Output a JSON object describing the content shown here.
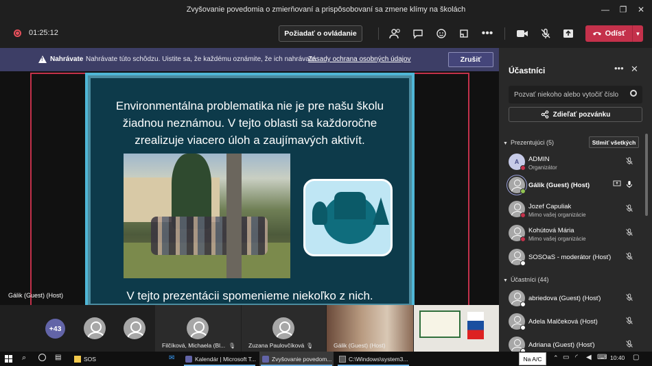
{
  "window": {
    "title": "Zvyšovanie povedomia o zmierňovaní a prispôsobovaní sa zmene klímy na školách",
    "minimize": "—",
    "maximize": "❐",
    "close": "✕"
  },
  "toolbar": {
    "timer": "01:25:12",
    "request_control": "Požiadať o ovládanie",
    "leave": "Odísť",
    "icons": [
      "participants-icon",
      "chat-icon",
      "reactions-icon",
      "rooms-icon",
      "more-icon",
      "camera-icon",
      "mic-off-icon",
      "share-icon"
    ]
  },
  "banner": {
    "title": "Nahrávate",
    "text": "Nahrávate túto schôdzu. Uistite sa, že každému oznámite, že ich nahrávate.",
    "link": "Zásady ochrana osobných údajov",
    "dismiss": "Zrušiť"
  },
  "stage": {
    "presenter_label": "Gálik (Guest) (Host)",
    "slide_text": "Environmentálna problematika nie je pre našu školu žiadnou neznámou. V tejto oblasti sa každoročne zrealizuje viacero úloh a zaujímavých aktivít.",
    "slide_bottom": "V tejto prezentácii spomenieme niekoľko z nich."
  },
  "strip": {
    "more_count": "+43",
    "tiles": [
      {
        "label": "Filčíková, Michaela (Bl..."
      },
      {
        "label": "Zuzana Paulovčíková"
      },
      {
        "label": "Gálik (Guest) (Host)"
      }
    ]
  },
  "panel": {
    "title": "Účastníci",
    "invite_placeholder": "Pozvať niekoho alebo vytočiť číslo",
    "share_invite": "Zdieľať pozvánku",
    "presenters_section": "Prezentujúci (5)",
    "mute_all": "Stlmiť všetkých",
    "attendees_section": "Účastníci (44)",
    "presenters": [
      {
        "name": "ADMIN",
        "sub": "Organizátor",
        "initial": "A",
        "status_color": "#c4314b"
      },
      {
        "name": "Gálik (Guest) (Host)",
        "sub": "",
        "initial": "",
        "status_color": "#92c353"
      },
      {
        "name": "Jozef Capuliak",
        "sub": "Mimo vašej organizácie",
        "initial": "",
        "status_color": "#c4314b"
      },
      {
        "name": "Kohútová Mária",
        "sub": "Mimo vašej organizácie",
        "initial": "",
        "status_color": "#c4314b"
      },
      {
        "name": "SOSOaS - moderátor (Hosť)",
        "sub": "",
        "initial": "",
        "status_color": "#ffffff"
      }
    ],
    "attendees": [
      {
        "name": "abriedova (Guest) (Hosť)",
        "status_color": "#ffffff"
      },
      {
        "name": "Adela Malčeková (Host)",
        "status_color": "#ffffff"
      },
      {
        "name": "Adriana (Guest) (Hosť)",
        "status_color": "#ffffff"
      }
    ]
  },
  "taskbar": {
    "items": [
      {
        "label": "SOS",
        "color": "#f2c94c"
      },
      {
        "label": "Kalendár | Microsoft T...",
        "color": "#6264a7"
      },
      {
        "label": "Zvyšovanie povedom...",
        "color": "#6264a7"
      },
      {
        "label": "C:\\Windows\\system3...",
        "color": "#555555"
      }
    ],
    "input_indicator": "Na A/C",
    "clock": "10:40"
  }
}
